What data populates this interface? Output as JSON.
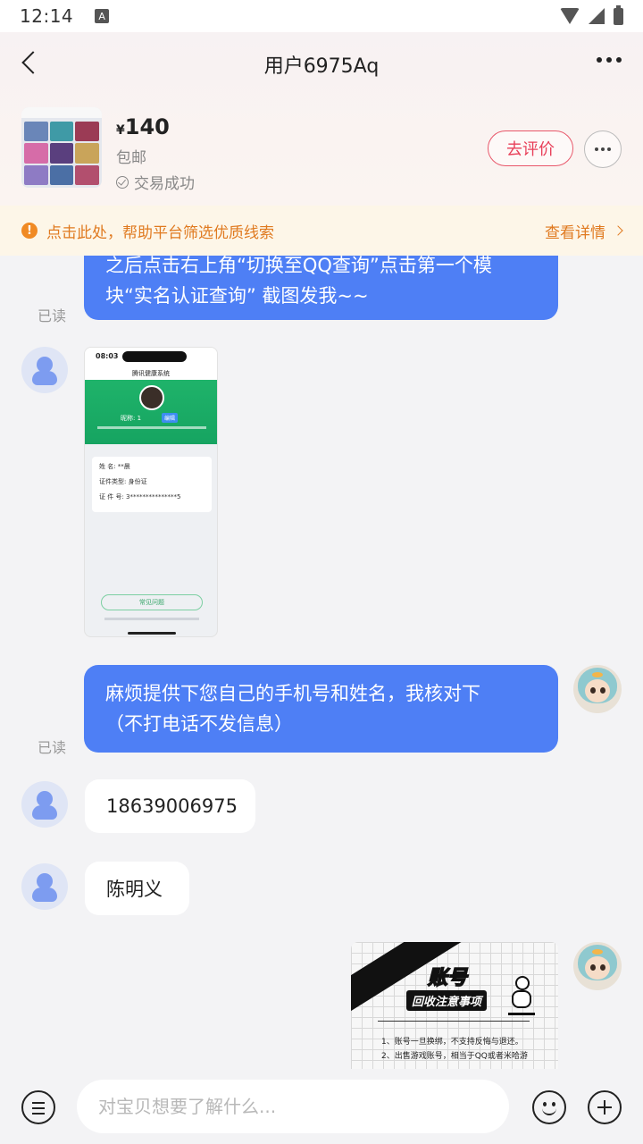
{
  "status_bar": {
    "time": "12:14",
    "indicator": "A",
    "icons": [
      "wifi-icon",
      "signal-icon",
      "battery-icon"
    ]
  },
  "header": {
    "title": "用户6975Aq",
    "product": {
      "currency": "¥",
      "price": "140",
      "shipping": "包邮",
      "deal_status": "交易成功"
    },
    "review_button": "去评价"
  },
  "notice": {
    "text": "点击此处，帮助平台筛选优质线索",
    "link": "查看详情"
  },
  "messages": {
    "m1": {
      "line1": "之后点击右上角“切换至QQ查询”点击第一个模",
      "line2": "块“实名认证查询” 截图发我~~",
      "read": "已读"
    },
    "screenshot": {
      "time": "08:03",
      "nav_title": "腾讯健康系统",
      "nickname": "昵称:    1",
      "badge": "编辑",
      "rows": [
        "姓    名:  **晨",
        "证件类型:  身份证",
        "证 件 号:  3***************5"
      ],
      "button": "常见问题"
    },
    "m2": {
      "line1": "麻烦提供下您自己的手机号和姓名，我核对下",
      "line2": "（不打电话不发信息）",
      "read": "已读"
    },
    "m3": {
      "text": "18639006975"
    },
    "m4": {
      "text": "陈明义"
    },
    "notice_image": {
      "title": "账号",
      "subtitle": "回收注意事项",
      "rule1": "1、账号一旦换绑，不支持反悔与退还。",
      "rule2": "2、出售游戏账号，相当于QQ或者米哈游"
    }
  },
  "input": {
    "placeholder": "对宝贝想要了解什么..."
  },
  "colors": {
    "bubble_out": "#4e7ff5",
    "accent_red": "#e8405a",
    "notice_orange": "#e07a20"
  }
}
